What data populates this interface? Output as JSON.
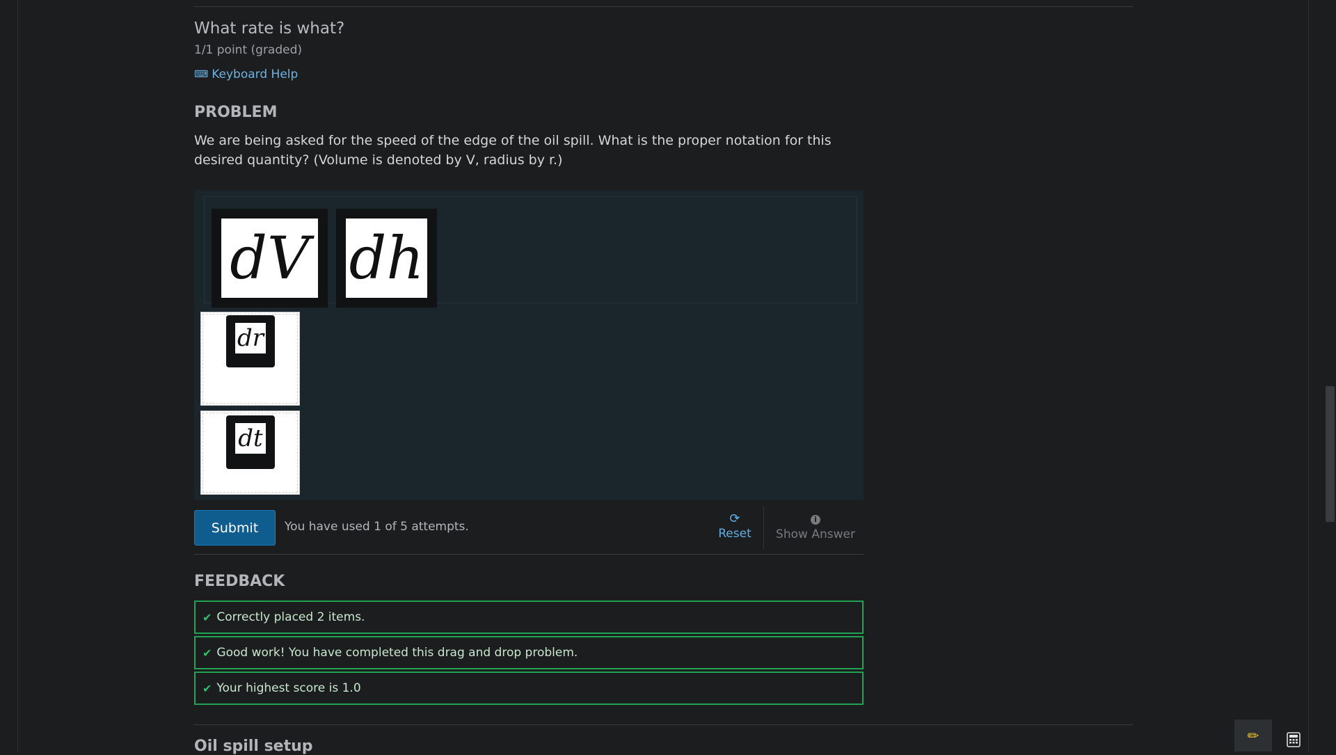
{
  "unit": {
    "title": "What rate is what?",
    "points": "1/1 point (graded)",
    "keyboard_help": "Keyboard Help"
  },
  "problem": {
    "heading": "PROBLEM",
    "text": "We are being asked for the speed of the edge of the oil spill. What is the proper notation for this desired quantity? (Volume is denoted by V, radius by r.)"
  },
  "drag_drop": {
    "source_items": [
      {
        "label": "dV"
      },
      {
        "label": "dh"
      }
    ],
    "placed_items": [
      {
        "label": "dr"
      },
      {
        "label": "dt"
      }
    ]
  },
  "actions": {
    "submit_label": "Submit",
    "attempts_text": "You have used 1 of 5 attempts.",
    "reset_label": "Reset",
    "show_answer_label": "Show Answer"
  },
  "feedback": {
    "heading": "FEEDBACK",
    "items": [
      "Correctly placed 2 items.",
      "Good work! You have completed this drag and drop problem.",
      "Your highest score is 1.0"
    ]
  },
  "next_section": {
    "title": "Oil spill setup"
  },
  "colors": {
    "background": "#1c1d1e",
    "link": "#6cb4e4",
    "submit": "#0f5d8f",
    "success": "#21a356",
    "edit_icon": "#f3c420"
  },
  "icons": [
    "keyboard-icon",
    "refresh-icon",
    "info-icon",
    "check-icon",
    "pencil-icon",
    "calculator-icon"
  ]
}
